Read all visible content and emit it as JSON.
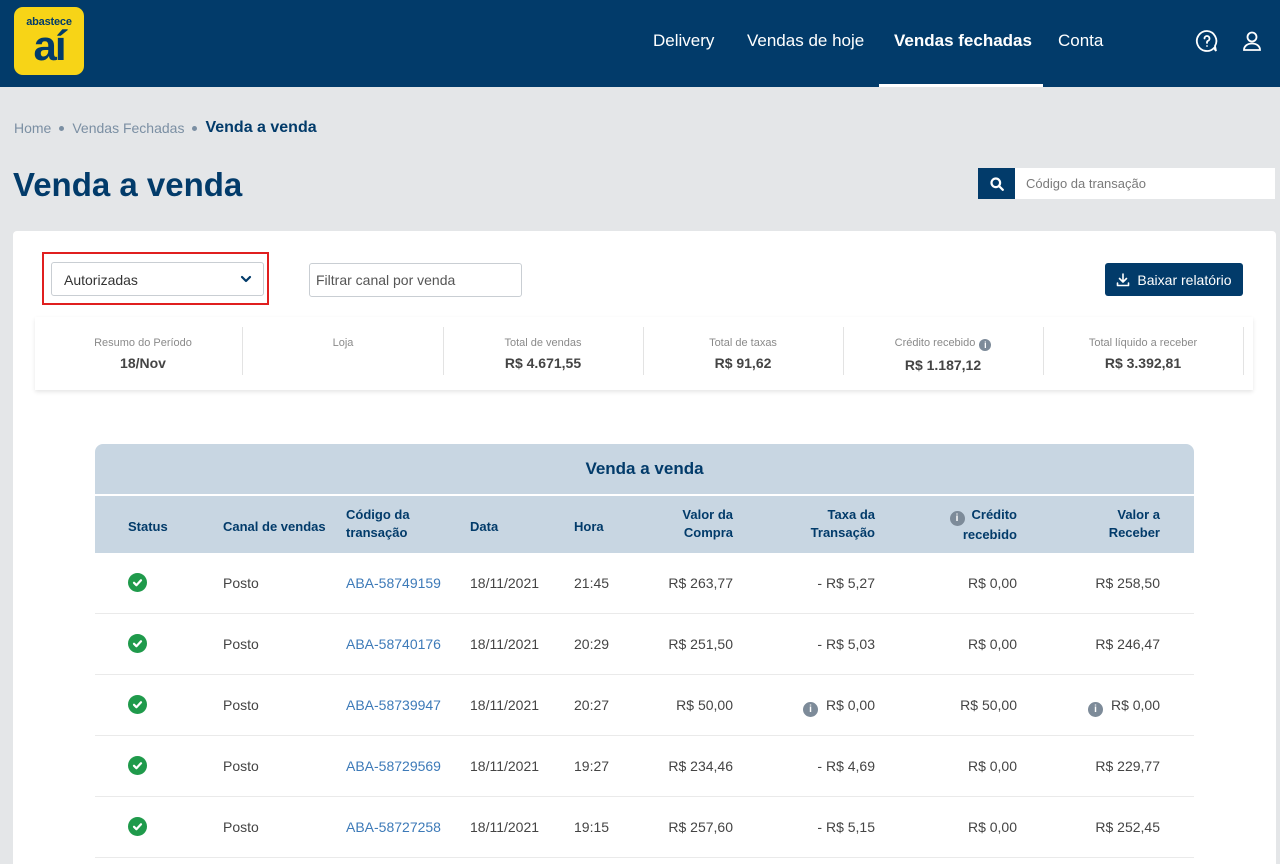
{
  "logo": {
    "line1": "abastece",
    "line2": "aí"
  },
  "nav": {
    "items": [
      {
        "label": "Delivery",
        "active": false
      },
      {
        "label": "Vendas de hoje",
        "active": false
      },
      {
        "label": "Vendas fechadas",
        "active": true
      },
      {
        "label": "Conta",
        "active": false
      }
    ]
  },
  "breadcrumb": {
    "items": [
      "Home",
      "Vendas Fechadas"
    ],
    "current": "Venda a venda"
  },
  "page_title": "Venda a venda",
  "search": {
    "placeholder": "Código da transação"
  },
  "filters": {
    "status_select": "Autorizadas",
    "channel_placeholder": "Filtrar canal por venda",
    "download_label": "Baixar relatório"
  },
  "summary": [
    {
      "label": "Resumo do Período",
      "value": "18/Nov"
    },
    {
      "label": "Loja",
      "value": ""
    },
    {
      "label": "Total de vendas",
      "value": "R$ 4.671,55"
    },
    {
      "label": "Total de taxas",
      "value": "R$ 91,62"
    },
    {
      "label": "Crédito recebido",
      "value": "R$ 1.187,12",
      "info": true
    },
    {
      "label": "Total líquido a receber",
      "value": "R$ 3.392,81"
    }
  ],
  "table": {
    "caption": "Venda a venda",
    "headers": {
      "status": "Status",
      "canal": "Canal de vendas",
      "codigo_1": "Código da",
      "codigo_2": "transação",
      "data": "Data",
      "hora": "Hora",
      "valor_1": "Valor da",
      "valor_2": "Compra",
      "taxa_1": "Taxa da",
      "taxa_2": "Transação",
      "credito_1": "Crédito",
      "credito_2": "recebido",
      "receber_1": "Valor a",
      "receber_2": "Receber"
    },
    "rows": [
      {
        "status": "success",
        "canal": "Posto",
        "codigo": "ABA-58749159",
        "data": "18/11/2021",
        "hora": "21:45",
        "valor": "R$ 263,77",
        "taxa": "- R$ 5,27",
        "taxa_info": false,
        "credito": "R$ 0,00",
        "receber": "R$ 258,50",
        "receber_info": false
      },
      {
        "status": "success",
        "canal": "Posto",
        "codigo": "ABA-58740176",
        "data": "18/11/2021",
        "hora": "20:29",
        "valor": "R$ 251,50",
        "taxa": "- R$ 5,03",
        "taxa_info": false,
        "credito": "R$ 0,00",
        "receber": "R$ 246,47",
        "receber_info": false
      },
      {
        "status": "success",
        "canal": "Posto",
        "codigo": "ABA-58739947",
        "data": "18/11/2021",
        "hora": "20:27",
        "valor": "R$ 50,00",
        "taxa": "R$ 0,00",
        "taxa_info": true,
        "credito": "R$ 50,00",
        "receber": "R$ 0,00",
        "receber_info": true
      },
      {
        "status": "success",
        "canal": "Posto",
        "codigo": "ABA-58729569",
        "data": "18/11/2021",
        "hora": "19:27",
        "valor": "R$ 234,46",
        "taxa": "- R$ 4,69",
        "taxa_info": false,
        "credito": "R$ 0,00",
        "receber": "R$ 229,77",
        "receber_info": false
      },
      {
        "status": "success",
        "canal": "Posto",
        "codigo": "ABA-58727258",
        "data": "18/11/2021",
        "hora": "19:15",
        "valor": "R$ 257,60",
        "taxa": "- R$ 5,15",
        "taxa_info": false,
        "credito": "R$ 0,00",
        "receber": "R$ 252,45",
        "receber_info": false
      }
    ]
  },
  "colors": {
    "brand_navy": "#023b6a",
    "brand_yellow": "#f7d417",
    "success": "#1f9a4b",
    "highlight": "#e01f1f",
    "link": "#3d7ab8"
  }
}
